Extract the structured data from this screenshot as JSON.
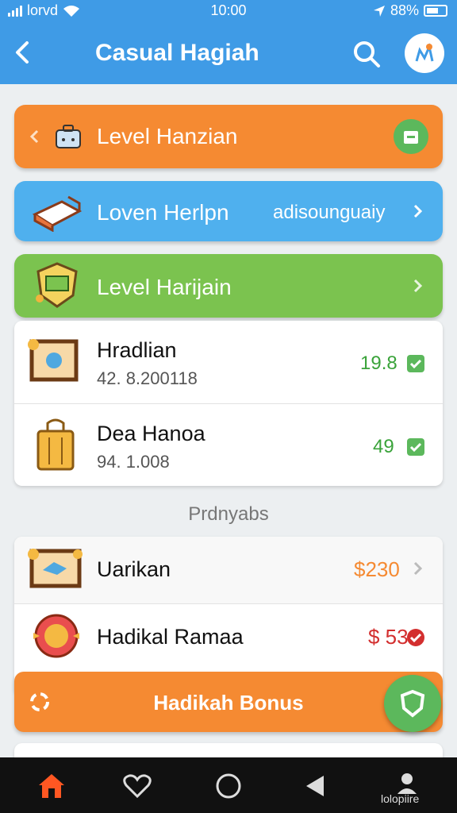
{
  "status": {
    "carrier": "lorvd",
    "time": "10:00",
    "battery": "88%"
  },
  "header": {
    "title": "Casual Hagiah"
  },
  "banners": [
    {
      "label": "Level Hanzian",
      "color": "#f58a32"
    },
    {
      "label": "Loven Herlpn",
      "right_text": "adisounguaiy",
      "color": "#4fb0ee"
    },
    {
      "label": "Level Harijain",
      "color": "#7bc34f"
    }
  ],
  "list1": [
    {
      "title": "Hradlian",
      "subtitle": "42. 8.200118",
      "value": "19.8",
      "value_color": "#3aa33a"
    },
    {
      "title": "Dea Hanoa",
      "subtitle": "94. 1.008",
      "value": "49",
      "value_color": "#3aa33a"
    }
  ],
  "section_title": "Prdnyabs",
  "list2": [
    {
      "title": "Uarikan",
      "value": "$230",
      "value_color": "#f58a32"
    },
    {
      "title": "Hadikal Ramaa",
      "value": "$ 531",
      "value_color": "#d32f2f"
    }
  ],
  "bonus": {
    "label": "Hadikah Bonus"
  },
  "nav": {
    "profile_label": "lolopiire"
  },
  "colors": {
    "header_bg": "#3f9be6",
    "accent_orange": "#f58a32",
    "accent_green": "#7bc34f",
    "nav_bg": "#111111",
    "home_icon": "#ff5722"
  },
  "icons": [
    "signal-icon",
    "wifi-icon",
    "location-arrow-icon",
    "battery-icon",
    "back-arrow-icon",
    "search-icon",
    "avatar-icon",
    "briefcase-icon",
    "store-icon",
    "book-icon",
    "shield-badge-icon",
    "chevron-right-icon",
    "frame-icon",
    "bag-icon",
    "check-icon",
    "medal-icon",
    "loading-icon",
    "shield-icon",
    "home-icon",
    "heart-icon",
    "circle-icon",
    "play-back-icon",
    "profile-icon"
  ]
}
